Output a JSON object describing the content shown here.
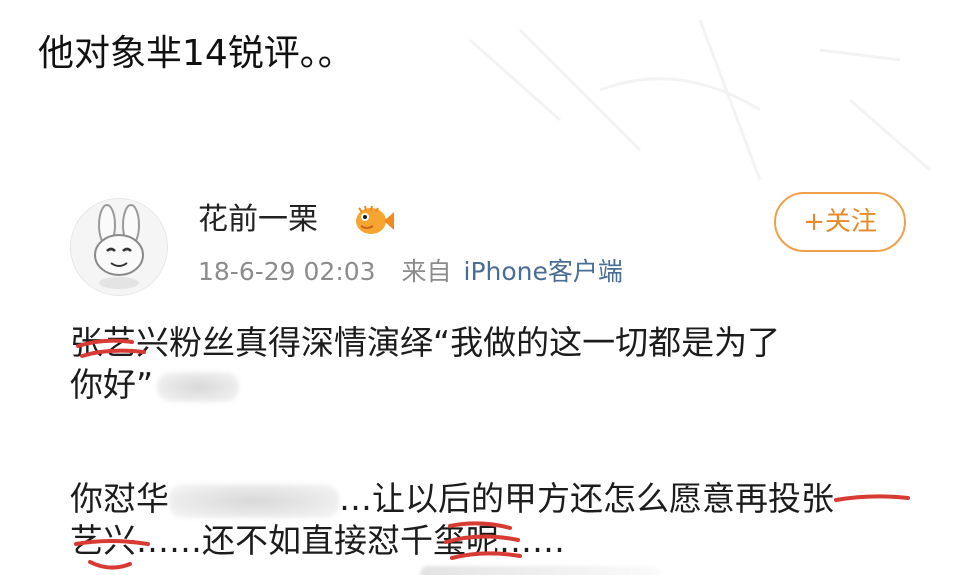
{
  "post": {
    "caption": "他对象芈14锐评。。"
  },
  "weibo_card": {
    "username": "花前一栗",
    "badge_icon": "puffer-fish-badge-icon",
    "timestamp": "18-6-29 02:03",
    "source_prefix": "来自",
    "client": "iPhone客户端",
    "follow_button": "+关注",
    "accent_color": "#e8892a",
    "paragraph1_line1": "张艺兴粉丝真得深情演绎“我做的这一切都是为了",
    "paragraph1_line2": "你好”",
    "paragraph2_line1_a": "你怼华",
    "paragraph2_line1_b": "…让以后的甲方还怎么愿意再投张",
    "paragraph2_line2": "艺兴……还不如直接怼千玺呢……"
  }
}
